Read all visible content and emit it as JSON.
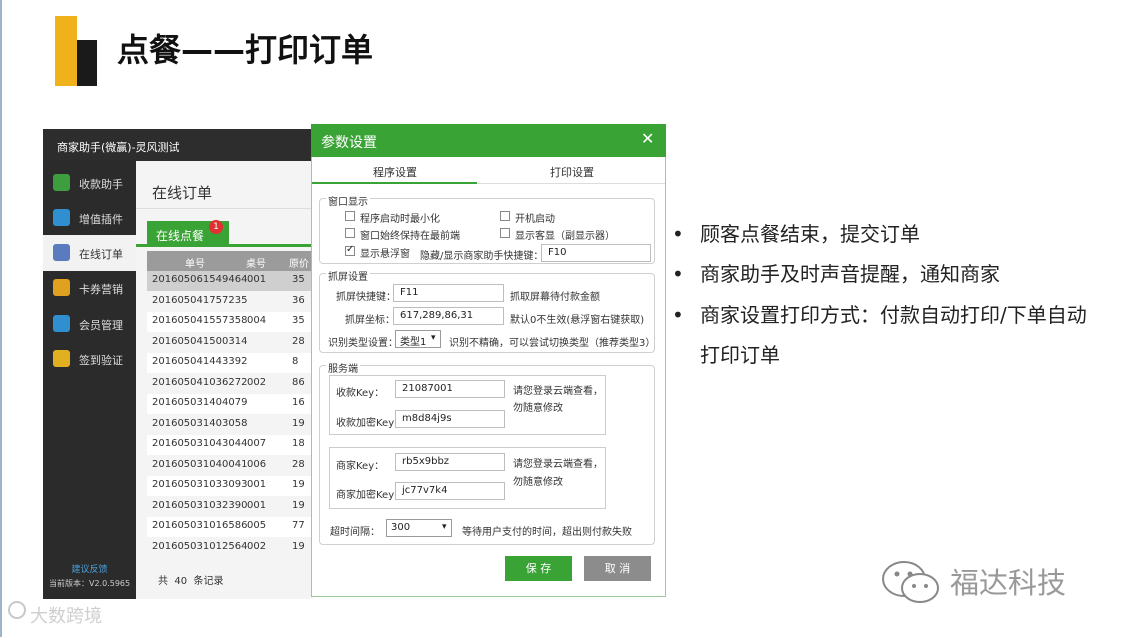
{
  "slide": {
    "title": "点餐——打印订单",
    "bullets": [
      "顾客点餐结束，提交订单",
      "商家助手及时声音提醒，通知商家",
      "商家设置打印方式：付款自动打印/下单自动",
      "打印订单"
    ],
    "wechat_brand": "福达科技",
    "watermark": "大数跨境",
    "bullet_symbol": "•"
  },
  "app": {
    "window_title": "商家助手(微赢)-灵风测试",
    "nav": [
      {
        "label": "收款助手",
        "icon": "wallet-icon",
        "color": "#3c9e3c"
      },
      {
        "label": "增值插件",
        "icon": "puzzle-icon",
        "color": "#2f8fd1"
      },
      {
        "label": "在线订单",
        "icon": "edit-icon",
        "color": "#5a7bbd"
      },
      {
        "label": "卡券营销",
        "icon": "layers-icon",
        "color": "#e0a020"
      },
      {
        "label": "会员管理",
        "icon": "user-icon",
        "color": "#2f8fd1"
      },
      {
        "label": "签到验证",
        "icon": "coins-icon",
        "color": "#e0b020"
      }
    ],
    "feedback": "建议反馈",
    "version": "当前版本：V2.0.5965",
    "main_title": "在线订单",
    "tab_label": "在线点餐",
    "tab_badge": "1",
    "columns": [
      "单号",
      "桌号",
      "原价"
    ],
    "rows": [
      [
        "201605061549464",
        "001",
        "35"
      ],
      [
        "201605041757235",
        "",
        "36"
      ],
      [
        "201605041557358",
        "004",
        "35"
      ],
      [
        "201605041500314",
        "",
        "28"
      ],
      [
        "201605041443392",
        "",
        "8"
      ],
      [
        "201605041036272",
        "002",
        "86"
      ],
      [
        "201605031404079",
        "",
        "16"
      ],
      [
        "201605031403058",
        "",
        "19"
      ],
      [
        "201605031043044",
        "007",
        "18"
      ],
      [
        "201605031040041",
        "006",
        "28"
      ],
      [
        "201605031033093",
        "001",
        "19"
      ],
      [
        "201605031032390",
        "001",
        "19"
      ],
      [
        "201605031016586",
        "005",
        "77"
      ],
      [
        "201605031012564",
        "002",
        "19"
      ]
    ],
    "footer": {
      "prefix": "共",
      "count": "40",
      "suffix": "条记录"
    }
  },
  "dialog": {
    "title": "参数设置",
    "close": "✕",
    "tabs": [
      "程序设置",
      "打印设置"
    ],
    "window_section": "窗口显示",
    "checkboxes": [
      {
        "label": "程序启动时最小化",
        "checked": false
      },
      {
        "label": "开机启动",
        "checked": false
      },
      {
        "label": "窗口始终保持在最前端",
        "checked": false
      },
      {
        "label": "显示客显（副显示器）",
        "checked": false
      },
      {
        "label": "显示悬浮窗",
        "checked": true
      }
    ],
    "check_mark": "✓",
    "hotkey_label": "隐藏/显示商家助手快捷键：",
    "hotkey_value": "F10",
    "capture_section": "抓屏设置",
    "capture_hotkey_label": "抓屏快捷键：",
    "capture_hotkey_value": "F11",
    "capture_hotkey_hint": "抓取屏幕待付款金额",
    "capture_coord_label": "抓屏坐标：",
    "capture_coord_value": "617,289,86,31",
    "capture_coord_hint": "默认0不生效(悬浮窗右键获取)",
    "recog_label": "识别类型设置：",
    "recog_value": "类型1",
    "recog_hint": "识别不精确，可以尝试切换类型（推荐类型3）",
    "server_section": "服务端",
    "pay_key_label": "收款Key：",
    "pay_key_value": "21087001",
    "pay_enc_label": "收款加密Key：",
    "pay_enc_value": "m8d84j9s",
    "merchant_key_label": "商家Key：",
    "merchant_key_value": "rb5x9bbz",
    "merchant_enc_label": "商家加密Key：",
    "merchant_enc_value": "jc77v7k4",
    "hint_line1": "请您登录云端查看，",
    "hint_line2": "勿随意修改",
    "timeout_label": "超时间隔：",
    "timeout_value": "300",
    "timeout_hint": "等待用户支付的时间，超出则付款失败",
    "save": "保 存",
    "cancel": "取 消",
    "dropdown_arrow": "▾"
  }
}
